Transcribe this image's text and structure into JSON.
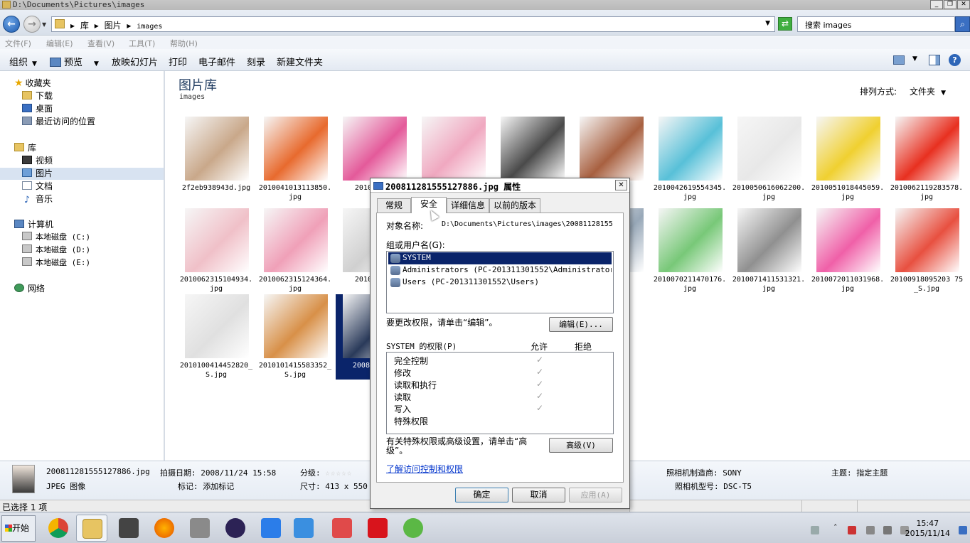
{
  "window": {
    "title": "D:\\Documents\\Pictures\\images",
    "controls": [
      "_",
      "❐",
      "✕"
    ]
  },
  "address": {
    "crumbs": [
      "▸",
      "库",
      "▸",
      "图片",
      "▸",
      "images"
    ],
    "search_placeholder": "搜索 images"
  },
  "menu": [
    "文件(F)",
    "编辑(E)",
    "查看(V)",
    "工具(T)",
    "帮助(H)"
  ],
  "toolbar": {
    "organize": "组织",
    "preview": "预览",
    "slideshow": "放映幻灯片",
    "print": "打印",
    "email": "电子邮件",
    "burn": "刻录",
    "new_folder": "新建文件夹"
  },
  "nav": {
    "favorites": "收藏夹",
    "downloads": "下载",
    "desktop": "桌面",
    "recent": "最近访问的位置",
    "libraries": "库",
    "videos": "视频",
    "pictures": "图片",
    "documents": "文档",
    "music": "音乐",
    "computer": "计算机",
    "disk_c": "本地磁盘 (C:)",
    "disk_d": "本地磁盘 (D:)",
    "disk_e": "本地磁盘 (E:)",
    "network": "网络"
  },
  "content": {
    "title": "图片库",
    "subtitle": "images",
    "arrange_label": "排列方式:",
    "arrange_value": "文件夹",
    "thumbnails": [
      {
        "caption": "2f2eb938943d.jpg",
        "color": "#c9a88a"
      },
      {
        "caption": "2010041013113850.jpg",
        "color": "#e86a2e"
      },
      {
        "caption": "20100416.",
        "color": "#e45a9a"
      },
      {
        "caption": "",
        "color": "#f0a8c0"
      },
      {
        "caption": "",
        "color": "#4a4a4a"
      },
      {
        "caption": "27",
        "color": "#a86040"
      },
      {
        "caption": "2010042619554345.jpg",
        "color": "#58c0d8"
      },
      {
        "caption": "2010050616062200.jpg",
        "color": "#e8e8e8"
      },
      {
        "caption": "2010051018445059.jpg",
        "color": "#f0d030"
      },
      {
        "caption": "2010062119283578.jpg",
        "color": "#e83020"
      },
      {
        "caption": "2010062315104934.jpg",
        "color": "#f0c0c8"
      },
      {
        "caption": "2010062315124364.jpg",
        "color": "#f0a0b8"
      },
      {
        "caption": "20100625.",
        "color": "#d0d0d0"
      },
      {
        "caption": "514",
        "color": "#98a8b8"
      },
      {
        "caption": "2010070211470176.jpg",
        "color": "#78c878"
      },
      {
        "caption": "2010071411531321.jpg",
        "color": "#909090"
      },
      {
        "caption": "2010072011031968.jpg",
        "color": "#f060a8"
      },
      {
        "caption": "20100918095203 75_S.jpg",
        "color": "#e85040"
      },
      {
        "caption": "2010100414452820_S.jpg",
        "color": "#e0e0e0"
      },
      {
        "caption": "2010101415583352_S.jpg",
        "color": "#d89048"
      },
      {
        "caption": "200811 886",
        "color": "#2a3a5a"
      }
    ]
  },
  "details": {
    "filename": "200811281555127886.jpg",
    "filetype": "JPEG 图像",
    "date_label": "拍摄日期: 2008/11/24 15:58",
    "tag_label": "标记: 添加标记",
    "rating_label": "分级:",
    "stars": "☆☆☆☆☆",
    "size_label": "尺寸: 413 x 550",
    "maker_label": "照相机制造商: SONY",
    "model_label": "照相机型号: DSC-T5",
    "subject_label": "主题: 指定主题"
  },
  "status": "已选择 1 项",
  "dialog": {
    "title": "200811281555127886.jpg 属性",
    "tabs": [
      "常规",
      "安全",
      "详细信息",
      "以前的版本"
    ],
    "object_label": "对象名称:",
    "object_value": "D:\\Documents\\Pictures\\images\\20081128155",
    "group_label": "组或用户名(G):",
    "users": [
      "SYSTEM",
      "Administrators (PC-201311301552\\Administrators)",
      "Users (PC-201311301552\\Users)"
    ],
    "edit_hint": "要更改权限，请单击“编辑”。",
    "edit_button": "编辑(E)...",
    "perm_header": "SYSTEM 的权限(P)",
    "allow": "允许",
    "deny": "拒绝",
    "permissions": [
      "完全控制",
      "修改",
      "读取和执行",
      "读取",
      "写入",
      "特殊权限"
    ],
    "check_mark": "✓",
    "advanced_hint": "有关特殊权限或高级设置，请单击“高级”。",
    "advanced_button": "高级(V)",
    "learn_link": "了解访问控制和权限",
    "ok": "确定",
    "cancel": "取消",
    "apply": "应用(A)"
  },
  "taskbar": {
    "start": "开始",
    "time": "15:47",
    "date": "2015/11/14",
    "tray_caret": "ˆ"
  }
}
